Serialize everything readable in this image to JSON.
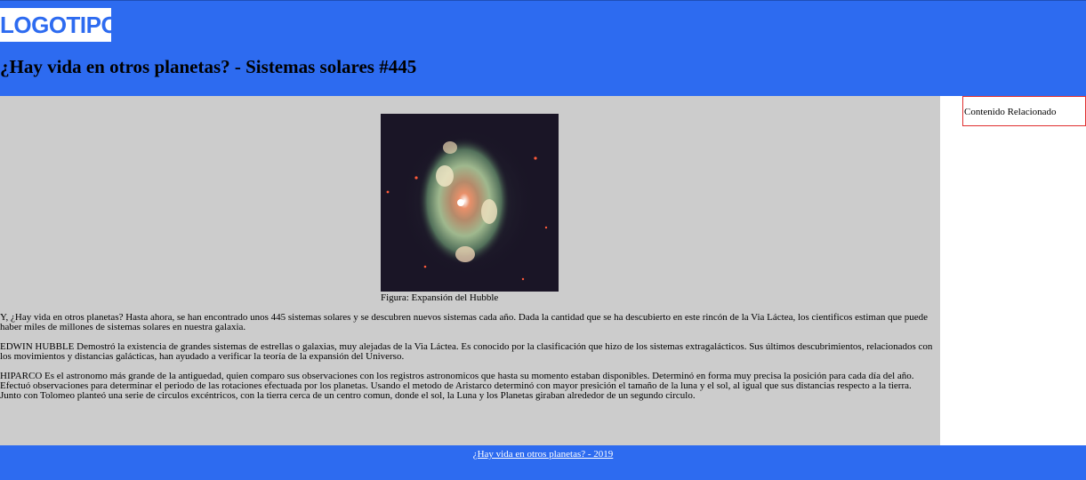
{
  "header": {
    "logo": "LOGOTIPO",
    "title": "¿Hay vida en otros planetas? - Sistemas solares #445"
  },
  "main": {
    "figure_caption": "Figura: Expansión del Hubble",
    "paragraphs": [
      "Y, ¿Hay vida en otros planetas? Hasta ahora, se han encontrado unos 445 sistemas solares y se descubren nuevos sistemas cada año. Dada la cantidad que se ha descubierto en este rincón de la Via Láctea, los cientificos estiman que puede haber miles de millones de sistemas solares en nuestra galaxia.",
      "EDWIN HUBBLE Demostró la existencia de grandes sistemas de estrellas o galaxias, muy alejadas de la Via Láctea. Es conocido por la clasificación que hizo de los sistemas extragalácticos. Sus últimos descubrimientos, relacionados con los movimientos y distancias galácticas, han ayudado a verificar la teoría de la expansión del Universo.",
      "HIPARCO Es el astronomo más grande de la antiguedad, quien comparo sus observaciones con los registros astronomicos que hasta su momento estaban disponibles. Determinó en forma muy precisa la posición para cada día del año. Efectuó observaciones para determinar el periodo de las rotaciones efectuada por los planetas. Usando el metodo de Aristarco determinó con mayor presición el tamaño de la luna y el sol, al igual que sus distancias respecto a la tierra. Junto con Tolomeo planteó una serie de circulos excéntricos, con la tierra cerca de un centro comun, donde el sol, la Luna y los Planetas giraban alrededor de un segundo circulo."
    ]
  },
  "aside": {
    "title": "Contenido Relacionado"
  },
  "footer": {
    "link": "¿Hay vida en otros planetas? - 2019"
  },
  "colors": {
    "header_bg": "#2d6bf0",
    "main_bg": "#cccccc",
    "aside_border": "#e03030"
  }
}
